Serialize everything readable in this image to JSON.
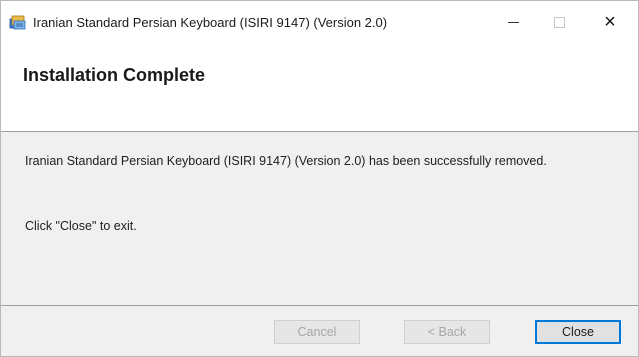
{
  "window": {
    "title": "Iranian Standard Persian Keyboard (ISIRI 9147) (Version 2.0)",
    "icon": "installer-icon",
    "controls": {
      "minimize": "minimize-icon",
      "maximize": "maximize-icon",
      "close": "×"
    }
  },
  "header": {
    "title": "Installation Complete"
  },
  "content": {
    "message": "Iranian Standard Persian Keyboard (ISIRI 9147) (Version 2.0) has been successfully removed.",
    "hint": "Click \"Close\" to exit."
  },
  "buttons": {
    "cancel": "Cancel",
    "back": "< Back",
    "close": "Close"
  },
  "colors": {
    "accent": "#0078d7",
    "window_bg": "#f0f0f0",
    "header_bg": "#ffffff"
  }
}
